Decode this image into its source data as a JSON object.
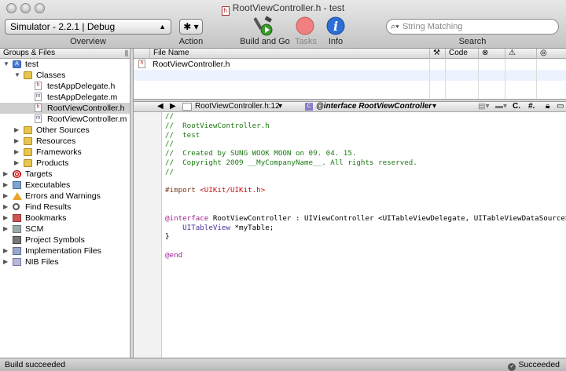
{
  "window": {
    "title": "RootViewController.h - test",
    "title_icon": "h"
  },
  "toolbar": {
    "overview_popup": "Simulator - 2.2.1 | Debug",
    "overview_label": "Overview",
    "action_glyph": "✱ ▾",
    "action_label": "Action",
    "build_go_label": "Build and Go",
    "tasks_label": "Tasks",
    "info_label": "Info",
    "search_placeholder": "String Matching",
    "search_label": "Search"
  },
  "sidebar": {
    "header": "Groups & Files",
    "items": [
      {
        "label": "test",
        "icon": "project-icon",
        "tri": "▼"
      },
      {
        "label": "Classes",
        "icon": "folder-icon",
        "tri": "▼"
      },
      {
        "label": "testAppDelegate.h",
        "icon": "header-file-icon",
        "tri": ""
      },
      {
        "label": "testAppDelegate.m",
        "icon": "implementation-file-icon",
        "tri": ""
      },
      {
        "label": "RootViewController.h",
        "icon": "header-file-icon",
        "tri": "",
        "selected": true
      },
      {
        "label": "RootViewController.m",
        "icon": "implementation-file-icon",
        "tri": ""
      },
      {
        "label": "Other Sources",
        "icon": "folder-icon",
        "tri": "▶"
      },
      {
        "label": "Resources",
        "icon": "folder-icon",
        "tri": "▶"
      },
      {
        "label": "Frameworks",
        "icon": "folder-icon",
        "tri": "▶"
      },
      {
        "label": "Products",
        "icon": "folder-icon",
        "tri": "▶"
      },
      {
        "label": "Targets",
        "icon": "target-icon",
        "tri": "▶"
      },
      {
        "label": "Executables",
        "icon": "executable-icon",
        "tri": "▶"
      },
      {
        "label": "Errors and Warnings",
        "icon": "warning-icon",
        "tri": "▶"
      },
      {
        "label": "Find Results",
        "icon": "find-icon",
        "tri": "▶"
      },
      {
        "label": "Bookmarks",
        "icon": "bookmark-icon",
        "tri": "▶"
      },
      {
        "label": "SCM",
        "icon": "scm-icon",
        "tri": "▶"
      },
      {
        "label": "Project Symbols",
        "icon": "symbols-icon",
        "tri": ""
      },
      {
        "label": "Implementation Files",
        "icon": "implementation-files-icon",
        "tri": "▶"
      },
      {
        "label": "NIB Files",
        "icon": "nib-files-icon",
        "tri": "▶"
      }
    ]
  },
  "file_list": {
    "columns": [
      "File Name",
      "Code"
    ],
    "rows": [
      {
        "name": "RootViewController.h"
      }
    ]
  },
  "editor_nav": {
    "file": "RootViewController.h:12",
    "symbol": "@interface RootViewController",
    "right_items": [
      "C.",
      "#."
    ]
  },
  "code": [
    {
      "t": "comment",
      "s": "//"
    },
    {
      "t": "comment",
      "s": "//  RootViewController.h"
    },
    {
      "t": "comment",
      "s": "//  test"
    },
    {
      "t": "comment",
      "s": "//"
    },
    {
      "t": "comment",
      "s": "//  Created by SUNG WOOK MOON on 09. 04. 15."
    },
    {
      "t": "comment",
      "s": "//  Copyright 2009 __MyCompanyName__. All rights reserved."
    },
    {
      "t": "comment",
      "s": "//"
    },
    {
      "t": "blank",
      "s": ""
    },
    {
      "t": "import",
      "a": "#import ",
      "b": "<UIKit/UIKit.h>"
    },
    {
      "t": "blank",
      "s": ""
    },
    {
      "t": "blank",
      "s": ""
    },
    {
      "t": "interface",
      "a": "@interface",
      "b": " RootViewController : UIViewController <UITableViewDelegate, UITableViewDataSource> {"
    },
    {
      "t": "ivar",
      "a": "    UITableView",
      "b": " *myTable;"
    },
    {
      "t": "plain",
      "s": "}"
    },
    {
      "t": "blank",
      "s": ""
    },
    {
      "t": "keyword",
      "s": "@end"
    }
  ],
  "status": {
    "left": "Build succeeded",
    "right": "Succeeded"
  }
}
